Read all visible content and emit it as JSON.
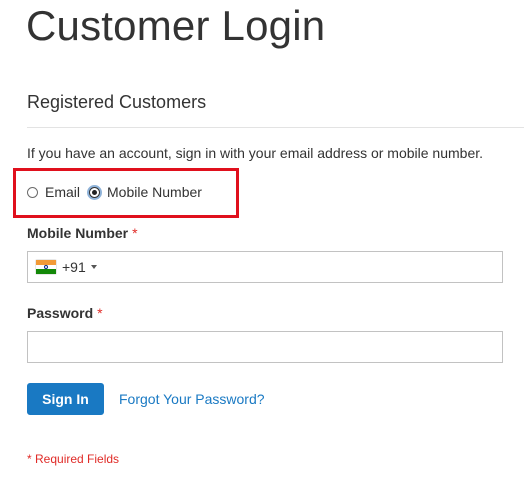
{
  "page": {
    "title": "Customer Login"
  },
  "login_block": {
    "section_title": "Registered Customers",
    "intro": "If you have an account, sign in with your email address or mobile number.",
    "login_type": {
      "options": [
        {
          "label": "Email",
          "checked": false
        },
        {
          "label": "Mobile Number",
          "checked": true
        }
      ]
    },
    "mobile_field": {
      "label": "Mobile Number",
      "required_marker": "*",
      "country_flag": "india-flag-icon",
      "dial_code": "+91",
      "value": ""
    },
    "password_field": {
      "label": "Password",
      "required_marker": "*",
      "value": ""
    },
    "sign_in_label": "Sign In",
    "forgot_password_label": "Forgot Your Password?",
    "required_note": "* Required Fields"
  },
  "colors": {
    "primary": "#1979c3",
    "required": "#e02b27",
    "highlight": "#e0101d",
    "text": "#333333",
    "flag_saffron": "#f29a36",
    "flag_white": "#ffffff",
    "flag_green": "#138808",
    "flag_chakra": "#0a2a8a"
  }
}
